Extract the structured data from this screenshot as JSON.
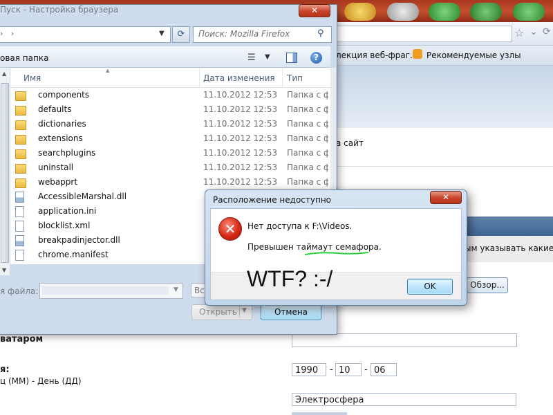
{
  "browser": {
    "search_placeholder": "Поиск: Mozilla Firefox",
    "bookmarks": [
      "лекция веб-фраг...",
      "Рекомендуемые узлы"
    ],
    "page_link_text": "а сайт",
    "gray_row_text": "ым указывать какие-л",
    "browse_button": "Обзор...",
    "avatar_label": "ватаром",
    "dob_label": "я:",
    "dob_hint": "ц (ММ) - День (ДД)",
    "dob_year": "1990",
    "dob_month": "10",
    "dob_day": "06",
    "dob_sep": "-",
    "city_value": "Электросфера"
  },
  "file_dialog": {
    "title": "Пуск - Настройка браузера",
    "close_label": "✕",
    "new_folder": "овая папка",
    "columns": {
      "name": "Имя",
      "date": "Дата изменения",
      "type": "Тип"
    },
    "rows": [
      {
        "name": "components",
        "date": "11.10.2012 12:53",
        "type": "Папка с ф",
        "kind": "folder"
      },
      {
        "name": "defaults",
        "date": "11.10.2012 12:53",
        "type": "Папка с ф",
        "kind": "folder"
      },
      {
        "name": "dictionaries",
        "date": "11.10.2012 12:53",
        "type": "Папка с ф",
        "kind": "folder"
      },
      {
        "name": "extensions",
        "date": "11.10.2012 12:53",
        "type": "Папка с ф",
        "kind": "folder"
      },
      {
        "name": "searchplugins",
        "date": "11.10.2012 12:53",
        "type": "Папка с ф",
        "kind": "folder"
      },
      {
        "name": "uninstall",
        "date": "11.10.2012 12:53",
        "type": "Папка с ф",
        "kind": "folder"
      },
      {
        "name": "webapprt",
        "date": "11.10.2012 12:53",
        "type": "Папка с ф",
        "kind": "folder"
      },
      {
        "name": "AccessibleMarshal.dll",
        "date": "",
        "type": "",
        "kind": "dll"
      },
      {
        "name": "application.ini",
        "date": "",
        "type": "",
        "kind": "file"
      },
      {
        "name": "blocklist.xml",
        "date": "",
        "type": "",
        "kind": "file"
      },
      {
        "name": "breakpadinjector.dll",
        "date": "",
        "type": "",
        "kind": "dll"
      },
      {
        "name": "chrome.manifest",
        "date": "",
        "type": "",
        "kind": "file"
      }
    ],
    "filename_label": "я файла:",
    "filter_value": "Все",
    "open_button": "Открыть",
    "cancel_button": "Отмена"
  },
  "error_dialog": {
    "title": "Расположение недоступно",
    "close_label": "✕",
    "message_line1": "Нет доступа к F:\\Videos.",
    "message_line2": "Превышен таймаут семафора.",
    "annotation": "WTF? :-/",
    "ok_button": "OK",
    "icon_glyph": "✕"
  },
  "colors": {
    "title_bar": "#c4502c",
    "error_icon": "#d42a18",
    "squiggle": "#2ecc40",
    "default_button": "#bee6fd"
  }
}
